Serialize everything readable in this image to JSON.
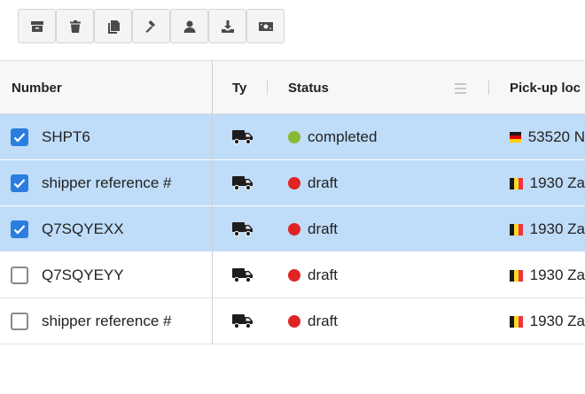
{
  "toolbar": {
    "buttons": [
      {
        "icon": "archive-icon"
      },
      {
        "icon": "trash-icon"
      },
      {
        "icon": "copy-icon"
      },
      {
        "icon": "gavel-icon"
      },
      {
        "icon": "user-icon"
      },
      {
        "icon": "download-icon"
      },
      {
        "icon": "money-icon"
      }
    ]
  },
  "columns": {
    "number": "Number",
    "type": "Ty",
    "status": "Status",
    "pickup": "Pick-up loc"
  },
  "colors": {
    "completed": "#8ab833",
    "draft": "#e02424",
    "selected_row": "#bfdcf8",
    "checkbox": "#2b7de0"
  },
  "rows": [
    {
      "selected": true,
      "number": "SHPT6",
      "type_icon": "truck-icon",
      "status": "completed",
      "flag": "de",
      "pickup": "53520 N"
    },
    {
      "selected": true,
      "number": "shipper reference #",
      "type_icon": "truck-icon",
      "status": "draft",
      "flag": "be",
      "pickup": "1930 Za"
    },
    {
      "selected": true,
      "number": "Q7SQYEXX",
      "type_icon": "truck-icon",
      "status": "draft",
      "flag": "be",
      "pickup": "1930 Za"
    },
    {
      "selected": false,
      "number": "Q7SQYEYY",
      "type_icon": "truck-icon",
      "status": "draft",
      "flag": "be",
      "pickup": "1930 Za"
    },
    {
      "selected": false,
      "number": "shipper reference #",
      "type_icon": "truck-icon",
      "status": "draft",
      "flag": "be",
      "pickup": "1930 Za"
    }
  ]
}
